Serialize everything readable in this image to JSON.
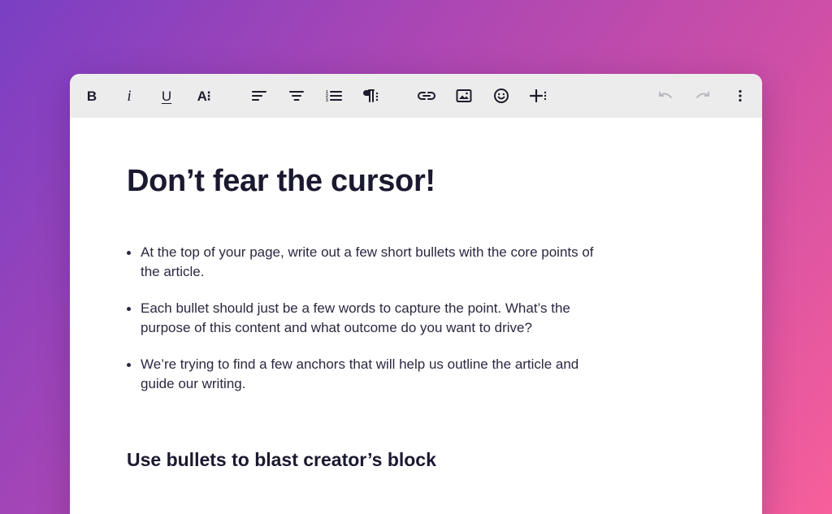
{
  "toolbar": {
    "buttons": [
      {
        "name": "bold",
        "label": "B",
        "icon": "bold-icon"
      },
      {
        "name": "italic",
        "label": "i",
        "icon": "italic-icon"
      },
      {
        "name": "underline",
        "label": "U",
        "icon": "underline-icon"
      },
      {
        "name": "font-size",
        "label": "A⁝",
        "icon": "font-size-icon"
      },
      {
        "name": "align-left",
        "icon": "align-left-icon"
      },
      {
        "name": "align-center",
        "icon": "align-center-icon"
      },
      {
        "name": "numbered-list",
        "icon": "numbered-list-icon"
      },
      {
        "name": "paragraph",
        "icon": "paragraph-icon"
      },
      {
        "name": "link",
        "icon": "link-icon"
      },
      {
        "name": "image",
        "icon": "image-icon"
      },
      {
        "name": "emoji",
        "icon": "emoji-icon"
      },
      {
        "name": "insert",
        "icon": "plus-icon"
      },
      {
        "name": "undo",
        "icon": "undo-icon",
        "disabled": true
      },
      {
        "name": "redo",
        "icon": "redo-icon",
        "disabled": true
      },
      {
        "name": "more",
        "icon": "more-vertical-icon"
      }
    ]
  },
  "document": {
    "title": "Don’t fear the cursor!",
    "bullets": [
      "At the top of your page, write out a few short bullets with the core points of the article.",
      "Each bullet should just be a few words to capture the point. What’s the purpose of this content and what outcome do you want to drive?",
      "We’re trying to find a few anchors that will help us outline the article and guide our writing."
    ],
    "subheading": "Use bullets to blast creator’s block"
  },
  "colors": {
    "gradient_start": "#7a3fc4",
    "gradient_end": "#f75f9a",
    "toolbar_bg": "#ececec",
    "text": "#1b1930",
    "disabled_icon": "#b4b4bc"
  }
}
